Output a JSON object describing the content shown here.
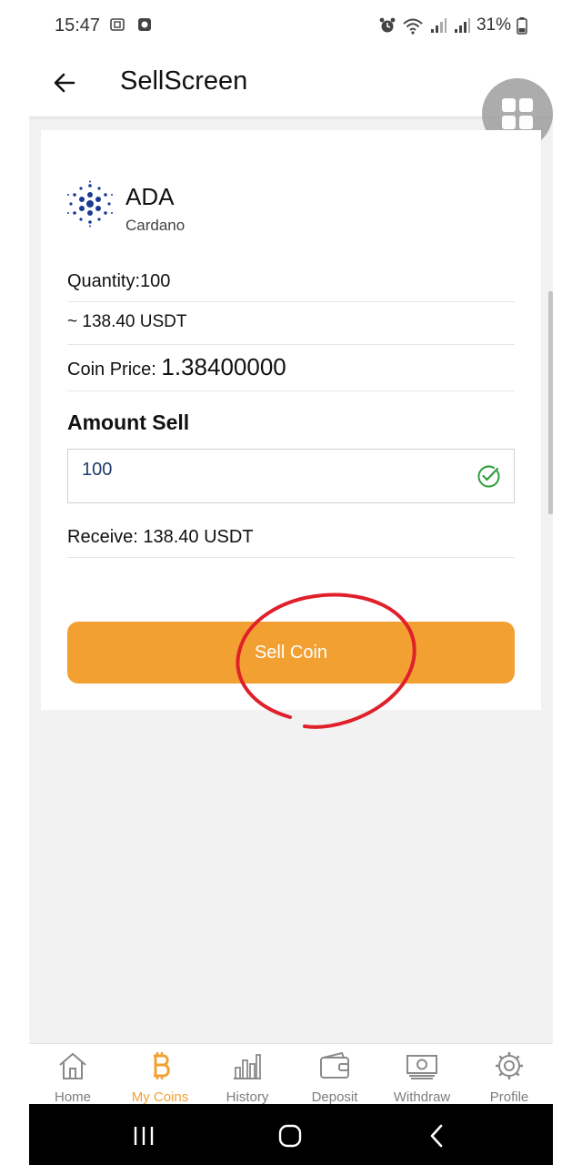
{
  "status_bar": {
    "time": "15:47",
    "battery": "31%"
  },
  "appbar": {
    "title": "SellScreen"
  },
  "coin": {
    "symbol": "ADA",
    "name": "Cardano"
  },
  "details": {
    "quantity": "Quantity:100",
    "usdt_estimate": "~ 138.40 USDT",
    "price_label": "Coin Price: ",
    "price_value": "1.38400000"
  },
  "amount": {
    "label": "Amount Sell",
    "value": "100"
  },
  "receive": "Receive: 138.40 USDT",
  "sell_button": "Sell Coin",
  "bottom_nav": [
    {
      "label": "Home",
      "icon": "home-icon"
    },
    {
      "label": "My Coins",
      "icon": "bitcoin-icon",
      "active": true
    },
    {
      "label": "History",
      "icon": "bar-chart-icon"
    },
    {
      "label": "Deposit",
      "icon": "wallet-icon"
    },
    {
      "label": "Withdraw",
      "icon": "cash-icon"
    },
    {
      "label": "Profile",
      "icon": "gear-icon"
    }
  ],
  "colors": {
    "accent": "#f3a033",
    "input_text": "#1d3c6e",
    "check": "#2e9e3a",
    "annotation": "#e0202a",
    "coin_logo": "#1a3b94"
  }
}
